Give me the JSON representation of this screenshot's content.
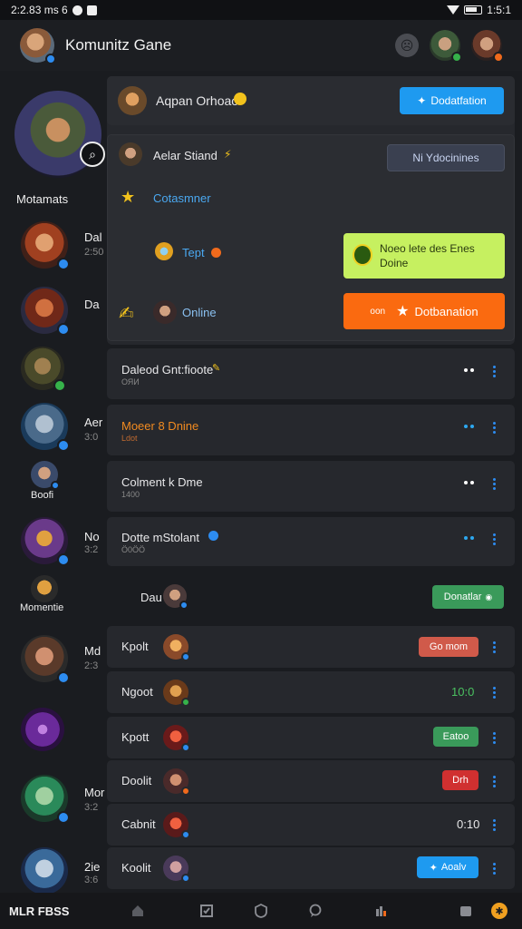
{
  "status": {
    "time_left": "2:2.83 ms 6",
    "time_right": "1:5:1"
  },
  "app": {
    "title": "Komunitz Gane"
  },
  "sidebar": {
    "featured_label": "Motamats",
    "items": [
      {
        "name": "Dal",
        "sub": "2:50"
      },
      {
        "name": "Da",
        "sub": ""
      },
      {
        "name": "",
        "sub": ""
      },
      {
        "name": "Aer",
        "sub": "3:0"
      },
      {
        "name": "Boofi",
        "sub": ""
      },
      {
        "name": "No",
        "sub": "3:2"
      },
      {
        "name": "Momentie",
        "sub": ""
      },
      {
        "name": "Md",
        "sub": "2:3"
      },
      {
        "name": "",
        "sub": ""
      },
      {
        "name": "Mor",
        "sub": "3:2"
      },
      {
        "name": "2ie",
        "sub": "3:6"
      }
    ]
  },
  "panel": {
    "user1": {
      "name": "Aqpan Orhoao",
      "button": "Dodatfation"
    },
    "user2": {
      "name": "Aelar Stiand",
      "button": "Ni Ydocinines"
    },
    "section_label": "Cotasmner",
    "user3": {
      "name": "Tept"
    },
    "notice": {
      "line1": "Noeo lete des Enes",
      "line2": "Doine"
    },
    "online_label": "Online",
    "cta_button": "Dotbanation",
    "cta_prefix": "oon"
  },
  "rows": [
    {
      "title": "Daleod Gnt:fioote",
      "sub": "ОЯИ"
    },
    {
      "title": "Moeer 8 Dnine",
      "sub": "Ldot"
    },
    {
      "title": "Colment k Dme",
      "sub": "1400"
    },
    {
      "title": "Dotte mStolant",
      "sub": "Ӧ0ӦӦ"
    }
  ],
  "rows_extra": {
    "plain_name": "Dau",
    "plain_button": "Donatlar"
  },
  "list": [
    {
      "name": "Kpolt",
      "value": "Go mom",
      "kind": "red-btn"
    },
    {
      "name": "Ngoot",
      "value": "10:0",
      "kind": "green-text"
    },
    {
      "name": "Kpott",
      "value": "Eatoo",
      "kind": "green-btn"
    },
    {
      "name": "Doolit",
      "value": "Drh",
      "kind": "red-small"
    },
    {
      "name": "Cabnit",
      "value": "0:10",
      "kind": "plain"
    },
    {
      "name": "Koolit",
      "value": "Aoalv",
      "kind": "blue-btn"
    }
  ],
  "nav": {
    "label": "MLR FBSS"
  },
  "icons": [
    "home-icon",
    "check-box-icon",
    "shield-icon",
    "chat-icon",
    "rank-icon",
    "shop-icon",
    "settings-icon"
  ],
  "colors": {
    "accent_blue": "#1e9af0",
    "accent_orange": "#fa6a10",
    "accent_lime": "#c6f060",
    "bg": "#1a1c20"
  }
}
